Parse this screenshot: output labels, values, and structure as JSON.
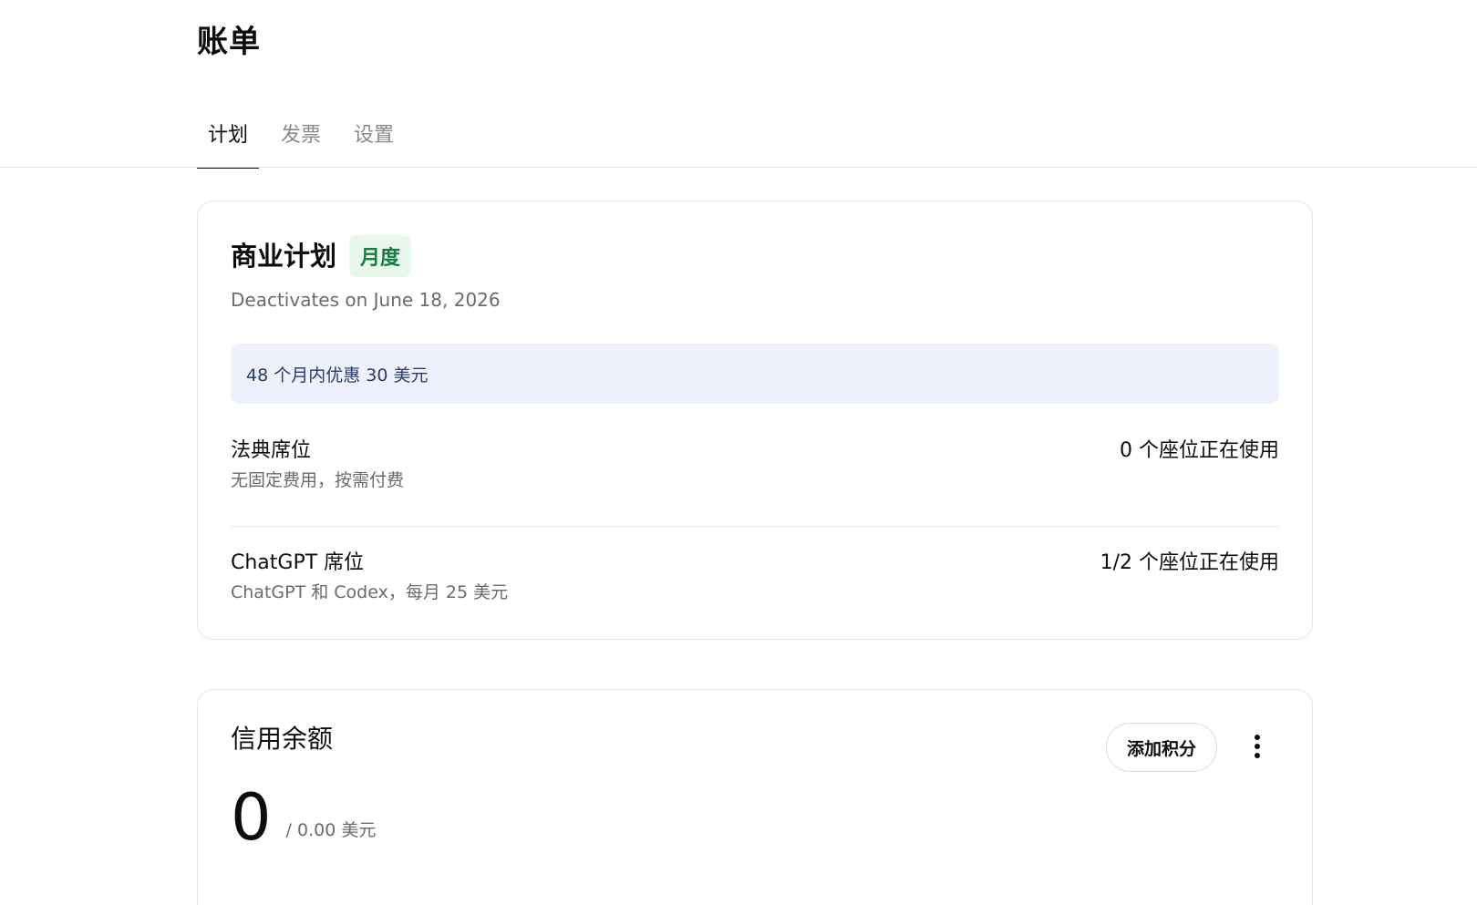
{
  "page": {
    "title": "账单"
  },
  "tabs": [
    {
      "label": "计划",
      "active": true
    },
    {
      "label": "发票",
      "active": false
    },
    {
      "label": "设置",
      "active": false
    }
  ],
  "plan": {
    "name": "商业计划",
    "badge": "月度",
    "status": "Deactivates on June 18, 2026",
    "discount": "48 个月内优惠 30 美元",
    "seats": [
      {
        "title": "法典席位",
        "description": "无固定费用，按需付费",
        "usage": "0 个座位正在使用"
      },
      {
        "title": "ChatGPT 席位",
        "description": "ChatGPT 和 Codex，每月 25 美元",
        "usage": "1/2 个座位正在使用"
      }
    ]
  },
  "credit": {
    "title": "信用余额",
    "add_button": "添加积分",
    "amount": "0",
    "total": "/ 0.00 美元"
  },
  "colors": {
    "badge_bg": "#e8f7ec",
    "badge_text": "#15803d",
    "discount_bg": "#eef1fc",
    "muted_text": "#6b6b6b"
  }
}
